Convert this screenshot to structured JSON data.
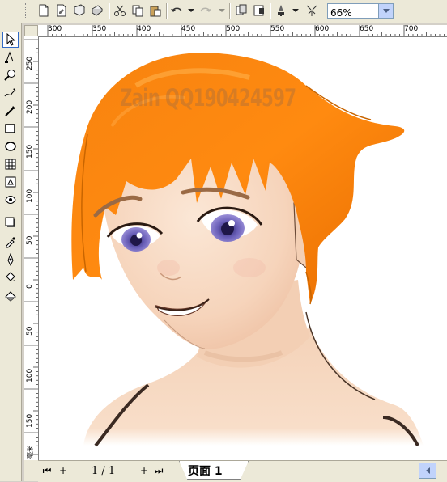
{
  "toolbar": {
    "zoom_value": "66%",
    "buttons": [
      "new-icon",
      "open-icon",
      "save-icon",
      "print-icon",
      "cut-icon",
      "copy-icon",
      "paste-icon",
      "undo-icon",
      "redo-icon",
      "import-icon",
      "export-icon",
      "application-launcher-icon",
      "welcome-icon"
    ]
  },
  "tools": [
    "pick-tool-icon",
    "shape-tool-icon",
    "zoom-tool-icon",
    "freehand-tool-icon",
    "smart-drawing-icon",
    "rectangle-tool-icon",
    "ellipse-tool-icon",
    "polygon-tool-icon",
    "basic-shapes-icon",
    "text-tool-icon",
    "interactive-shadow-icon",
    "eyedropper-icon",
    "outline-tool-icon",
    "fill-tool-icon",
    "interactive-fill-icon"
  ],
  "rulers": {
    "unit_label": "毫米",
    "h_ticks": [
      "300",
      "350",
      "400",
      "450",
      "500",
      "550",
      "600",
      "650",
      "700"
    ],
    "v_ticks": [
      "250",
      "200",
      "150",
      "100",
      "50",
      "0",
      "50",
      "100",
      "150"
    ]
  },
  "canvas": {
    "watermark": "Zain QQ190424597"
  },
  "pagebar": {
    "page_count": "1 / 1",
    "page_tab": "页面 1"
  }
}
